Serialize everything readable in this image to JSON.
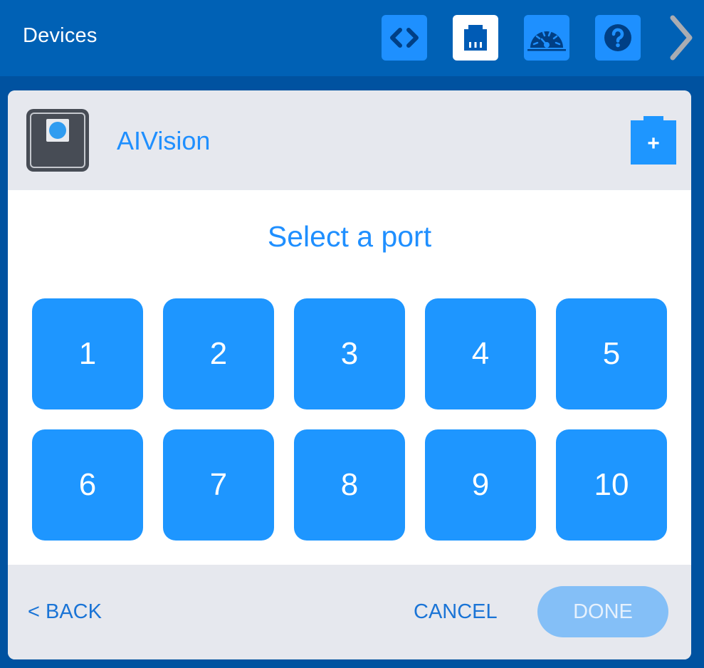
{
  "header": {
    "title": "Devices",
    "buttons": [
      {
        "name": "code-icon",
        "active": false
      },
      {
        "name": "ports-icon",
        "active": true
      },
      {
        "name": "dashboard-icon",
        "active": false
      },
      {
        "name": "help-icon",
        "active": false
      }
    ],
    "more_icon": "chevron-right-icon"
  },
  "device": {
    "name": "AIVision",
    "icon": "ai-vision-sensor-icon",
    "add_icon": "add-device-icon",
    "add_label": "+"
  },
  "port_picker": {
    "title": "Select a port",
    "ports": [
      "1",
      "2",
      "3",
      "4",
      "5",
      "6",
      "7",
      "8",
      "9",
      "10"
    ]
  },
  "footer": {
    "back_label": "< BACK",
    "cancel_label": "CANCEL",
    "done_label": "DONE"
  },
  "colors": {
    "brand": "#0061b5",
    "accent": "#1e96ff",
    "panel_gray": "#e6e8ee",
    "done_disabled": "#84bff7"
  }
}
